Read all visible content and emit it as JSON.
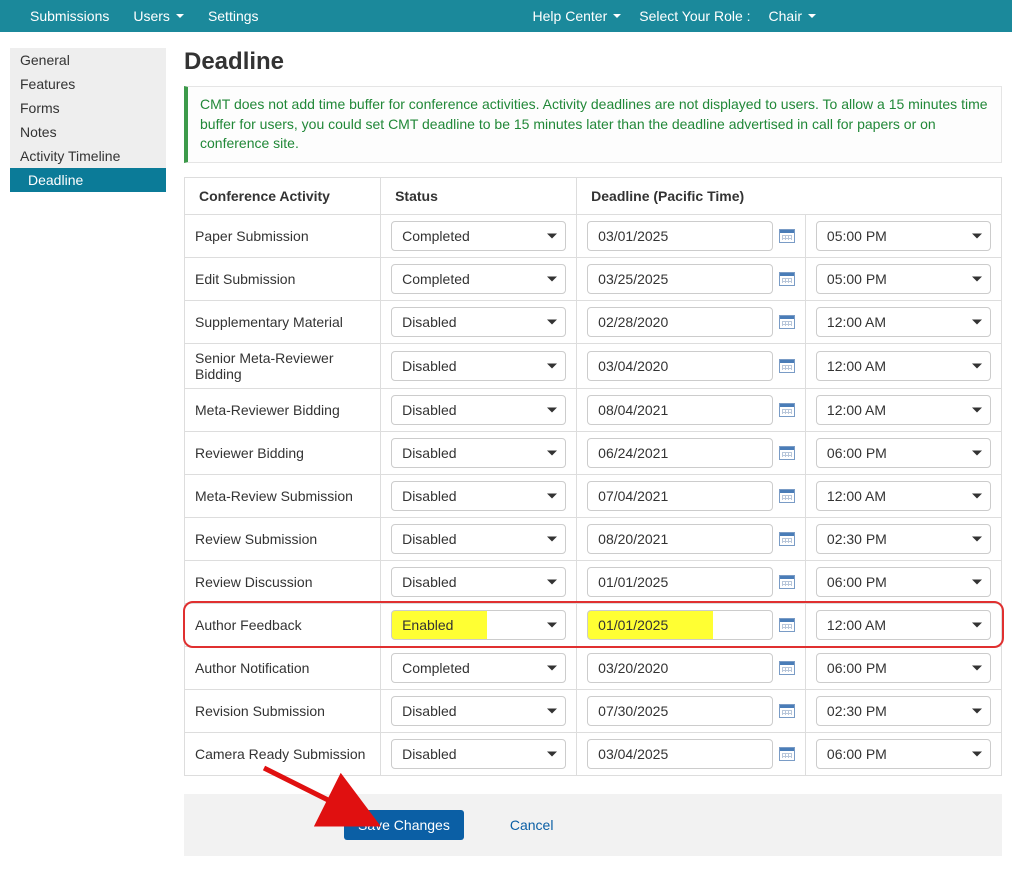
{
  "topbar": {
    "left": [
      {
        "label": "Submissions",
        "caret": false
      },
      {
        "label": "Users",
        "caret": true
      },
      {
        "label": "Settings",
        "caret": false
      }
    ],
    "help_center": "Help Center",
    "select_role_label": "Select Your Role :",
    "role": "Chair"
  },
  "sidebar": {
    "items": [
      {
        "label": "General",
        "active": false
      },
      {
        "label": "Features",
        "active": false
      },
      {
        "label": "Forms",
        "active": false
      },
      {
        "label": "Notes",
        "active": false
      },
      {
        "label": "Activity Timeline",
        "active": false
      },
      {
        "label": "Deadline",
        "active": true
      }
    ]
  },
  "page": {
    "title": "Deadline",
    "info": "CMT does not add time buffer for conference activities. Activity deadlines are not displayed to users. To allow a 15 minutes time buffer for users, you could set CMT deadline to be 15 minutes later than the deadline advertised in call for papers or on conference site."
  },
  "table": {
    "headers": {
      "activity": "Conference Activity",
      "status": "Status",
      "deadline": "Deadline (Pacific Time)"
    },
    "rows": [
      {
        "activity": "Paper Submission",
        "status": "Completed",
        "date": "03/01/2025",
        "time": "05:00 PM",
        "highlight": false
      },
      {
        "activity": "Edit Submission",
        "status": "Completed",
        "date": "03/25/2025",
        "time": "05:00 PM",
        "highlight": false
      },
      {
        "activity": "Supplementary Material",
        "status": "Disabled",
        "date": "02/28/2020",
        "time": "12:00 AM",
        "highlight": false
      },
      {
        "activity": "Senior Meta-Reviewer Bidding",
        "status": "Disabled",
        "date": "03/04/2020",
        "time": "12:00 AM",
        "highlight": false
      },
      {
        "activity": "Meta-Reviewer Bidding",
        "status": "Disabled",
        "date": "08/04/2021",
        "time": "12:00 AM",
        "highlight": false
      },
      {
        "activity": "Reviewer Bidding",
        "status": "Disabled",
        "date": "06/24/2021",
        "time": "06:00 PM",
        "highlight": false
      },
      {
        "activity": "Meta-Review Submission",
        "status": "Disabled",
        "date": "07/04/2021",
        "time": "12:00 AM",
        "highlight": false
      },
      {
        "activity": "Review Submission",
        "status": "Disabled",
        "date": "08/20/2021",
        "time": "02:30 PM",
        "highlight": false
      },
      {
        "activity": "Review Discussion",
        "status": "Disabled",
        "date": "01/01/2025",
        "time": "06:00 PM",
        "highlight": false
      },
      {
        "activity": "Author Feedback",
        "status": "Enabled",
        "date": "01/01/2025",
        "time": "12:00 AM",
        "highlight": true
      },
      {
        "activity": "Author Notification",
        "status": "Completed",
        "date": "03/20/2020",
        "time": "06:00 PM",
        "highlight": false
      },
      {
        "activity": "Revision Submission",
        "status": "Disabled",
        "date": "07/30/2025",
        "time": "02:30 PM",
        "highlight": false
      },
      {
        "activity": "Camera Ready Submission",
        "status": "Disabled",
        "date": "03/04/2025",
        "time": "06:00 PM",
        "highlight": false
      }
    ]
  },
  "footer": {
    "save": "Save Changes",
    "cancel": "Cancel"
  }
}
